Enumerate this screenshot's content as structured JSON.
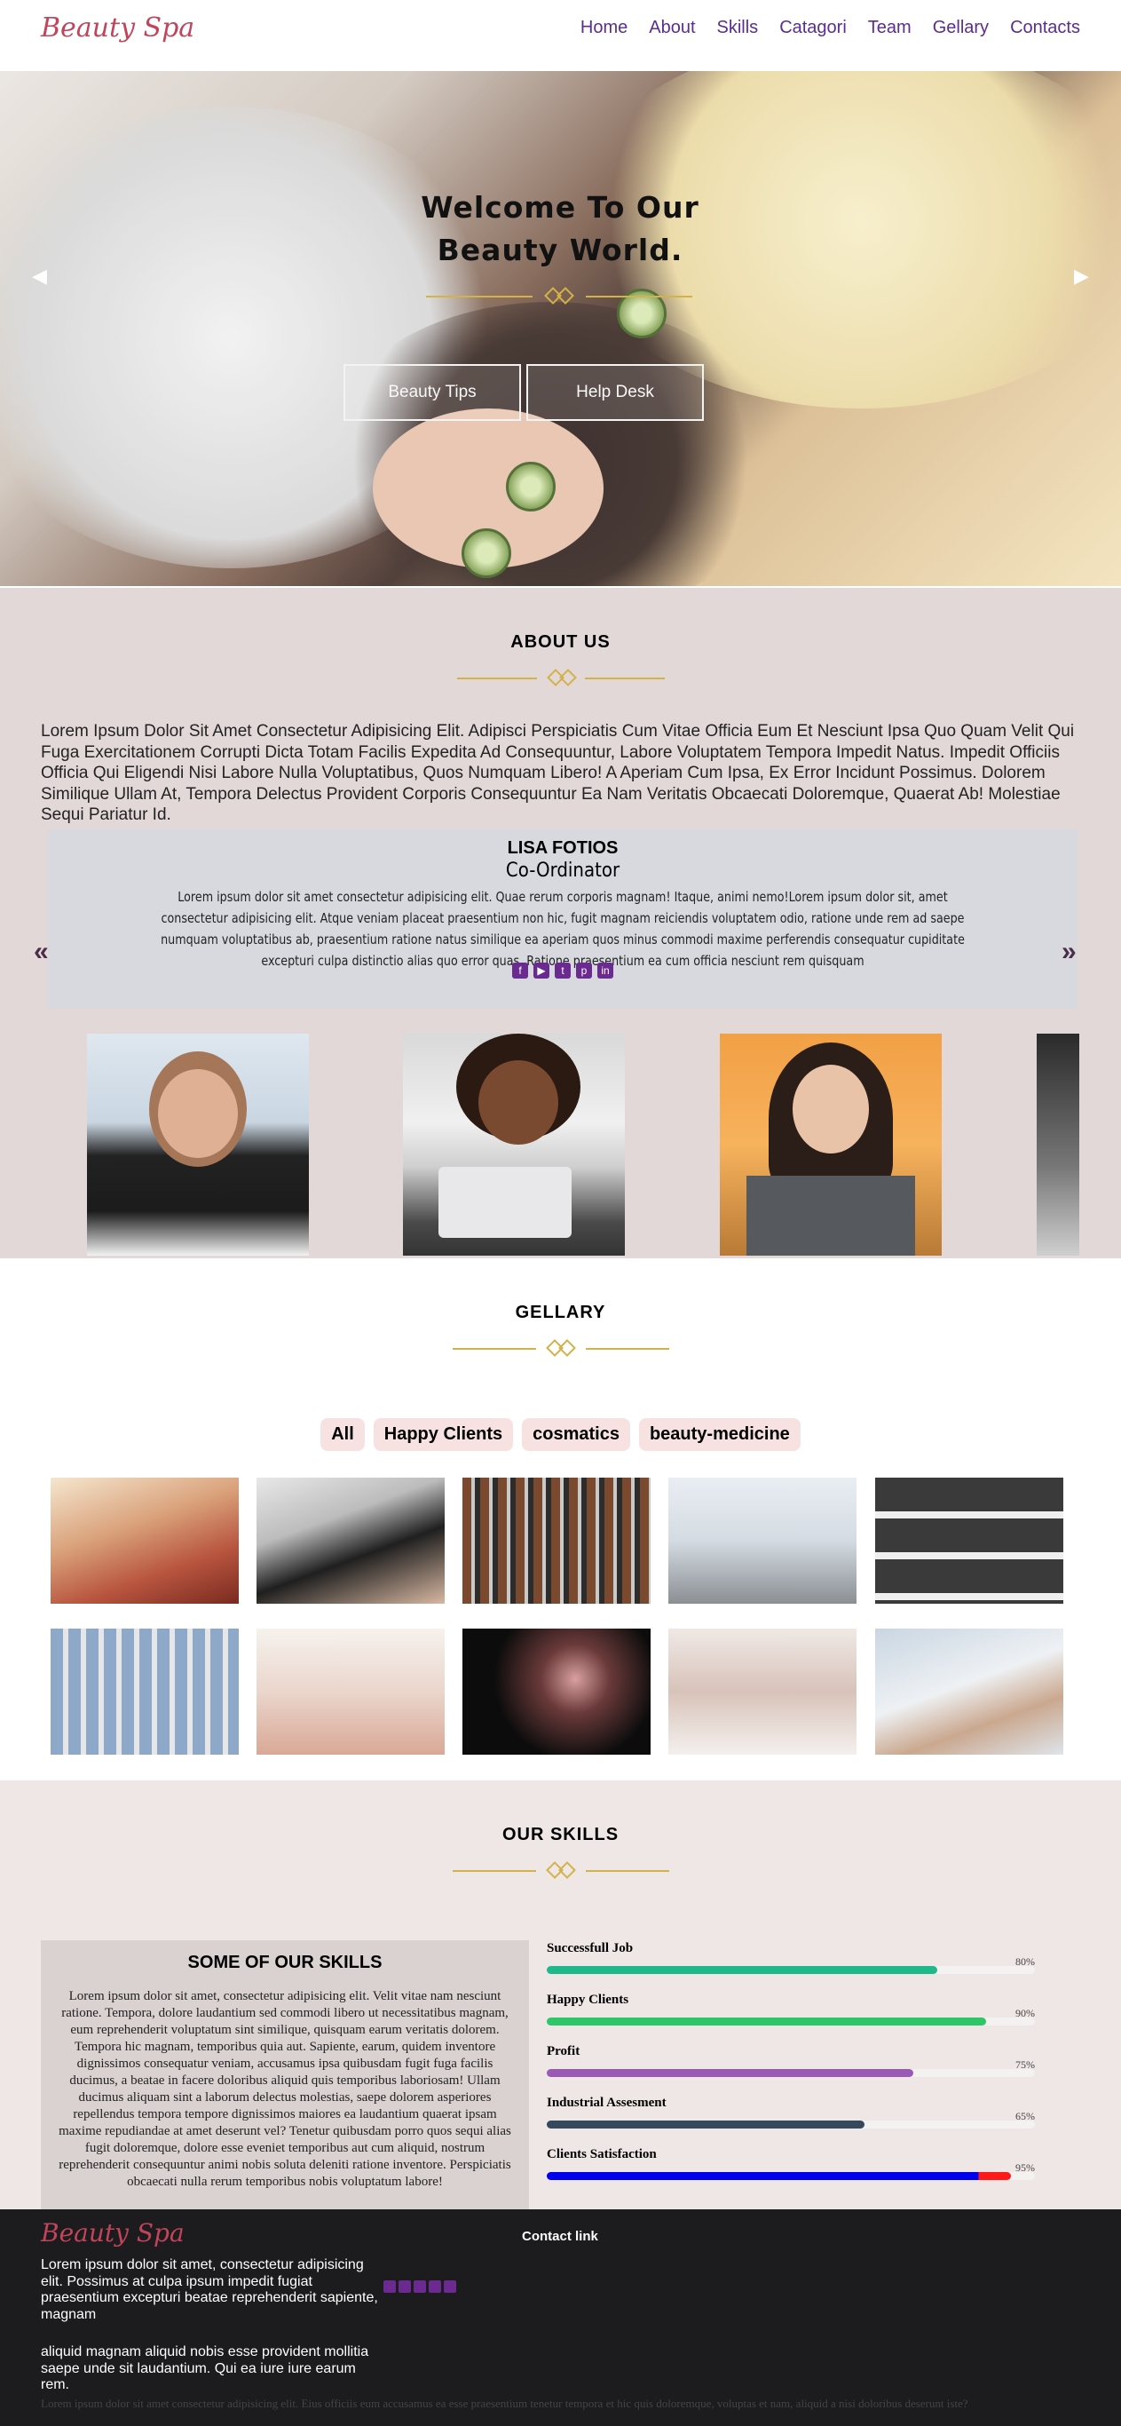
{
  "brand": {
    "logo_text": "Beauty Spa",
    "accent": "#c0445a",
    "menu_color": "#5b2d91"
  },
  "nav": {
    "items": [
      {
        "label": "Home"
      },
      {
        "label": "About"
      },
      {
        "label": "Skills"
      },
      {
        "label": "Catagori"
      },
      {
        "label": "Team"
      },
      {
        "label": "Gellary"
      },
      {
        "label": "Contacts"
      }
    ]
  },
  "hero": {
    "title_line1": "Welcome To Our",
    "title_line2": "Beauty World.",
    "btn_tips": "Beauty Tips",
    "btn_help": "Help Desk",
    "prev_icon": "triangle-left",
    "next_icon": "triangle-right"
  },
  "about": {
    "title": "ABOUT US",
    "text": "Lorem Ipsum Dolor Sit Amet Consectetur Adipisicing Elit. Adipisci Perspiciatis Cum Vitae Officia Eum Et Nesciunt Ipsa Quo Quam Velit Qui Fuga Exercitationem Corrupti Dicta Totam Facilis Expedita Ad Consequuntur, Labore Voluptatem Tempora Impedit Natus. Impedit Officiis Officia Qui Eligendi Nisi Labore Nulla Voluptatibus, Quos Numquam Libero! A Aperiam Cum Ipsa, Ex Error Incidunt Possimus. Dolorem Similique Ullam At, Tempora Delectus Provident Corporis Consequuntur Ea Nam Veritatis Obcaecati Doloremque, Quaerat Ab! Molestiae Sequi Pariatur Id.",
    "member": {
      "name": "LISA FOTIOS",
      "role": "Co-Ordinator",
      "bio": "Lorem ipsum dolor sit amet consectetur adipisicing elit. Quae rerum corporis magnam! Itaque, animi nemo!Lorem ipsum dolor sit, amet consectetur adipisicing elit. Atque veniam placeat praesentium non hic, fugit magnam reiciendis voluptatem odio, ratione unde rem ad saepe numquam voluptatibus ab, praesentium ratione natus similique ea aperiam quos minus commodi maxime perferendis consequatur cupiditate excepturi culpa distinctio alias quo error quas. Ratione praesentium ea cum officia nesciunt rem quisquam",
      "social_icons": [
        "facebook-icon",
        "youtube-icon",
        "twitter-icon",
        "pinterest-icon",
        "linkedin-icon"
      ]
    },
    "prev_label": "«",
    "next_label": "»"
  },
  "gallery": {
    "title": "GELLARY",
    "filters": [
      "All",
      "Happy Clients",
      "cosmatics",
      "beauty-medicine"
    ]
  },
  "skills": {
    "title": "OUR SKILLS",
    "box_title": "SOME OF OUR SKILLS",
    "box_text": "Lorem ipsum dolor sit amet, consectetur adipisicing elit. Velit vitae nam nesciunt ratione. Tempora, dolore laudantium sed commodi libero ut necessitatibus magnam, eum reprehenderit voluptatum sint similique, quisquam earum veritatis dolorem. Tempora hic magnam, temporibus quia aut. Sapiente, earum, quidem inventore dignissimos consequatur veniam, accusamus ipsa quibusdam fugit fuga facilis ducimus, a beatae in facere doloribus aliquid quis temporibus laboriosam! Ullam ducimus aliquam sint a laborum delectus molestias, saepe dolorem asperiores repellendus tempora tempore dignissimos maiores ea laudantium quaerat ipsam maxime repudiandae at amet deserunt vel? Tenetur quibusdam porro quos sequi alias fugit doloremque, dolore esse eveniet temporibus aut cum aliquid, nostrum reprehenderit consequuntur animi nobis soluta deleniti ratione inventore. Perspiciatis obcaecati nulla rerum temporibus nobis voluptatum labore!",
    "bars": [
      {
        "label": "Successfull Job",
        "pct_text": "80%",
        "value": 80,
        "color": "#1fb88a"
      },
      {
        "label": "Happy Clients",
        "pct_text": "90%",
        "value": 90,
        "color": "#2ec768"
      },
      {
        "label": "Profit",
        "pct_text": "75%",
        "value": 75,
        "color": "#9b59b6"
      },
      {
        "label": "Industrial Assesment",
        "pct_text": "65%",
        "value": 65,
        "color": "#34495e"
      },
      {
        "label": "Clients Satisfaction",
        "pct_text": "95%",
        "value": 95,
        "color": "#0000ee"
      }
    ]
  },
  "footer": {
    "logo_text": "Beauty Spa",
    "p1": "Lorem ipsum dolor sit amet, consectetur adipisicing elit. Possimus at culpa ipsum impedit fugiat praesentium excepturi beatae reprehenderit sapiente, magnam",
    "p2": "aliquid magnam aliquid nobis esse provident mollitia saepe unde sit laudantium. Qui ea iure iure earum rem.",
    "contact_title": "Contact link",
    "copy": "Lorem ipsum dolor sit amet consectetur adipisicing elit. Eius officiis eum accusamus ea esse praesentium tenetur tempora et hic quis doloremque, voluptas et nam, aliquid a nisi doloribus deserunt iste?"
  }
}
